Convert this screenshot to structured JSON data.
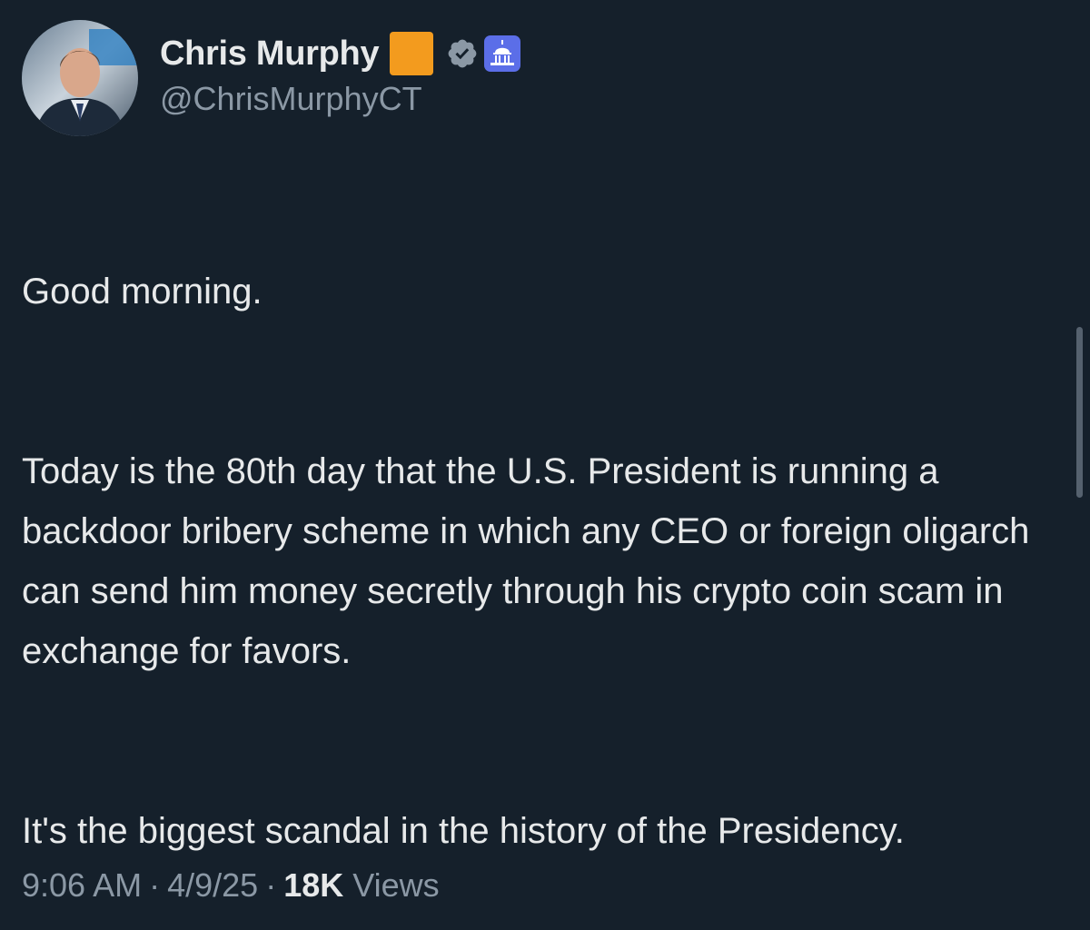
{
  "author": {
    "display_name": "Chris Murphy",
    "handle": "@ChrisMurphyCT",
    "avatar_icon": "profile-photo",
    "badges": [
      "orange-square-emoji",
      "verified-icon",
      "capitol-icon"
    ]
  },
  "tweet": {
    "paragraphs": [
      "Good morning.",
      "Today is the 80th day that the U.S. President is running a backdoor bribery scheme in which any CEO or foreign oligarch can send him money secretly through his crypto coin scam in exchange for favors.",
      "It's the biggest scandal in the history of the Presidency."
    ]
  },
  "meta": {
    "time": "9:06 AM",
    "date": "4/9/25",
    "views_count": "18K",
    "views_label": "Views",
    "separator": "·"
  },
  "colors": {
    "background": "#15202b",
    "text": "#e7e9ea",
    "secondary_text": "#8b98a5",
    "flag_orange": "#f39b1e",
    "capitol_blue": "#5b6ee8"
  }
}
